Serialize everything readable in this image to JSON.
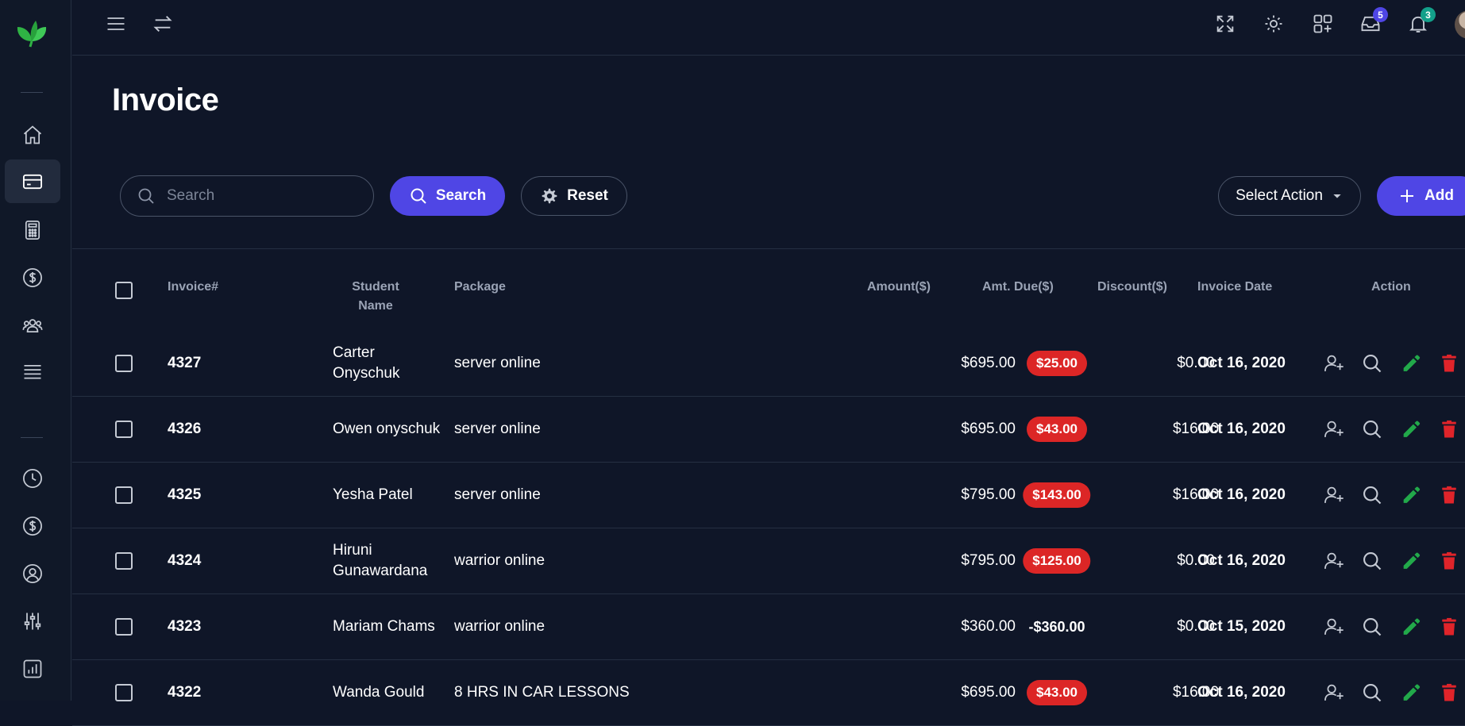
{
  "page": {
    "title": "Invoice"
  },
  "topbar": {
    "icons": [
      "menu-icon",
      "swap-icon",
      "fullscreen-icon",
      "theme-sun-icon",
      "apps-icon",
      "inbox-icon",
      "bell-icon"
    ],
    "inbox_badge": "5",
    "notification_badge": "3"
  },
  "sidebar": {
    "items": [
      "home-icon",
      "card-icon",
      "calculator-icon",
      "dollar-icon",
      "users-icon",
      "list-icon",
      "clock-icon",
      "dollar-icon",
      "profile-icon",
      "sliders-icon",
      "chart-icon"
    ],
    "active": "card-icon"
  },
  "toolbar": {
    "search_placeholder": "Search",
    "search_label": "Search",
    "reset_label": "Reset",
    "select_action_label": "Select Action",
    "add_label": "Add"
  },
  "table": {
    "headers": {
      "invoice": "Invoice#",
      "student": "Student Name",
      "package": "Package",
      "amount": "Amount($)",
      "due": "Amt. Due($)",
      "discount": "Discount($)",
      "date": "Invoice Date",
      "action": "Action"
    },
    "rows": [
      {
        "invoice": "4327",
        "student": "Carter Onyschuk",
        "package": "server online",
        "amount": "$695.00",
        "due": "$25.00",
        "due_negative": false,
        "discount": "$0.00",
        "date": "Oct 16, 2020"
      },
      {
        "invoice": "4326",
        "student": "Owen onyschuk",
        "package": "server online",
        "amount": "$695.00",
        "due": "$43.00",
        "due_negative": false,
        "discount": "$16.00",
        "date": "Oct 16, 2020"
      },
      {
        "invoice": "4325",
        "student": "Yesha Patel",
        "package": "server online",
        "amount": "$795.00",
        "due": "$143.00",
        "due_negative": false,
        "discount": "$16.00",
        "date": "Oct 16, 2020"
      },
      {
        "invoice": "4324",
        "student": "Hiruni Gunawardana",
        "package": "warrior online",
        "amount": "$795.00",
        "due": "$125.00",
        "due_negative": false,
        "discount": "$0.00",
        "date": "Oct 16, 2020"
      },
      {
        "invoice": "4323",
        "student": "Mariam Chams",
        "package": "warrior online",
        "amount": "$360.00",
        "due": "-$360.00",
        "due_negative": true,
        "discount": "$0.00",
        "date": "Oct 15, 2020"
      },
      {
        "invoice": "4322",
        "student": "Wanda Gould",
        "package": "8 HRS IN CAR LESSONS",
        "amount": "$695.00",
        "due": "$43.00",
        "due_negative": false,
        "discount": "$16.00",
        "date": "Oct 16, 2020"
      }
    ]
  },
  "colors": {
    "accent": "#4f46e5",
    "danger": "#dc2626",
    "edit": "#22a94a",
    "delete": "#e0242a",
    "badge_inbox": "#4f46e5",
    "badge_bell": "#13a08a"
  }
}
